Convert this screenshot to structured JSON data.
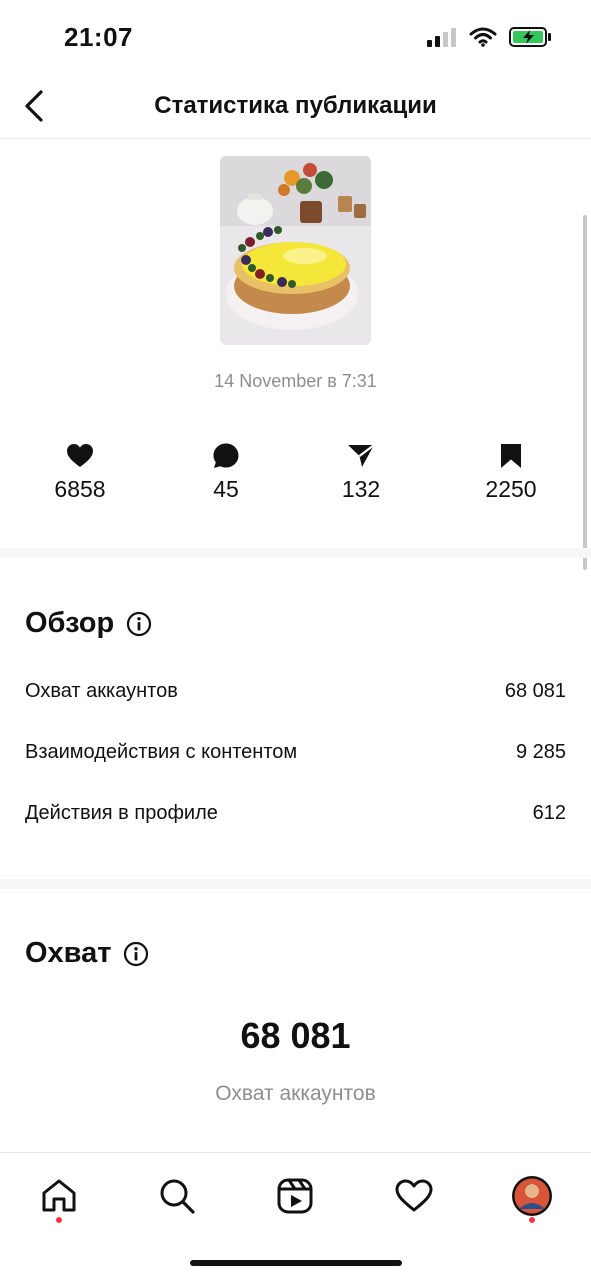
{
  "status_bar": {
    "time": "21:07",
    "battery": "charging"
  },
  "nav": {
    "title": "Статистика публикации"
  },
  "post": {
    "date": "14 November в 7:31"
  },
  "metrics": [
    {
      "icon": "heart-icon",
      "value": "6858"
    },
    {
      "icon": "comment-icon",
      "value": "45"
    },
    {
      "icon": "share-icon",
      "value": "132"
    },
    {
      "icon": "bookmark-icon",
      "value": "2250"
    }
  ],
  "overview": {
    "title": "Обзор",
    "rows": [
      {
        "label": "Охват аккаунтов",
        "value": "68 081"
      },
      {
        "label": "Взаимодействия с контентом",
        "value": "9 285"
      },
      {
        "label": "Действия в профиле",
        "value": "612"
      }
    ]
  },
  "reach": {
    "title": "Охват",
    "value": "68 081",
    "label": "Охват аккаунтов"
  },
  "tabs": [
    {
      "icon": "home-icon",
      "badge": true
    },
    {
      "icon": "search-icon",
      "badge": false
    },
    {
      "icon": "reels-icon",
      "badge": false
    },
    {
      "icon": "activity-heart-icon",
      "badge": false
    },
    {
      "icon": "profile-avatar",
      "badge": true
    }
  ],
  "colors": {
    "accent_dot": "#ff3040",
    "muted_text": "#8e8e8e",
    "battery_green": "#34c759"
  }
}
